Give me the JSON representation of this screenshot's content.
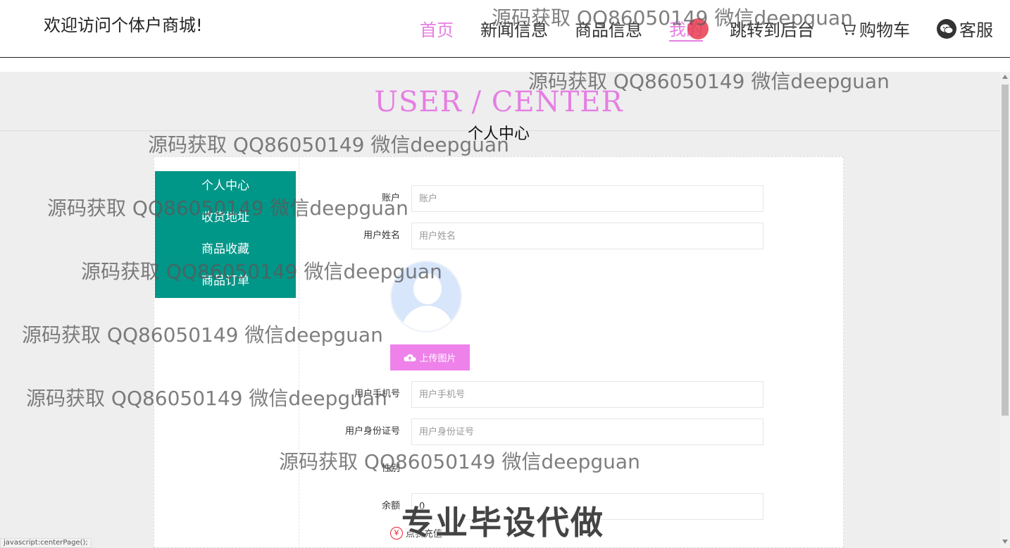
{
  "header": {
    "site_title": "欢迎访问个体户商城!",
    "nav": {
      "home": "首页",
      "news": "新闻信息",
      "goods": "商品信息",
      "mine": "我的",
      "backend": "跳转到后台",
      "cart": "购物车",
      "service": "客服"
    }
  },
  "banner": {
    "title_en": "USER / CENTER",
    "title_cn": "个人中心"
  },
  "sidebar": {
    "items": [
      "个人中心",
      "收货地址",
      "商品收藏",
      "商品订单"
    ]
  },
  "form": {
    "account": {
      "label": "账户",
      "placeholder": "账户"
    },
    "username": {
      "label": "用户姓名",
      "placeholder": "用户姓名"
    },
    "upload_label": "上传图片",
    "phone": {
      "label": "用户手机号",
      "placeholder": "用户手机号"
    },
    "idcard": {
      "label": "用户身份证号",
      "placeholder": "用户身份证号"
    },
    "gender": {
      "label": "性别"
    },
    "balance": {
      "label": "余额",
      "value": "0"
    },
    "recharge_label": "点我充值"
  },
  "watermark": {
    "text": "源码获取 QQ86050149 微信deepguan",
    "big_text": "专业毕设代做"
  },
  "status_bar": "javascript:centerPage();",
  "colors": {
    "accent_pink": "#e57ee2",
    "sidebar_teal": "#009688",
    "banner_gray": "#eeeeef"
  }
}
